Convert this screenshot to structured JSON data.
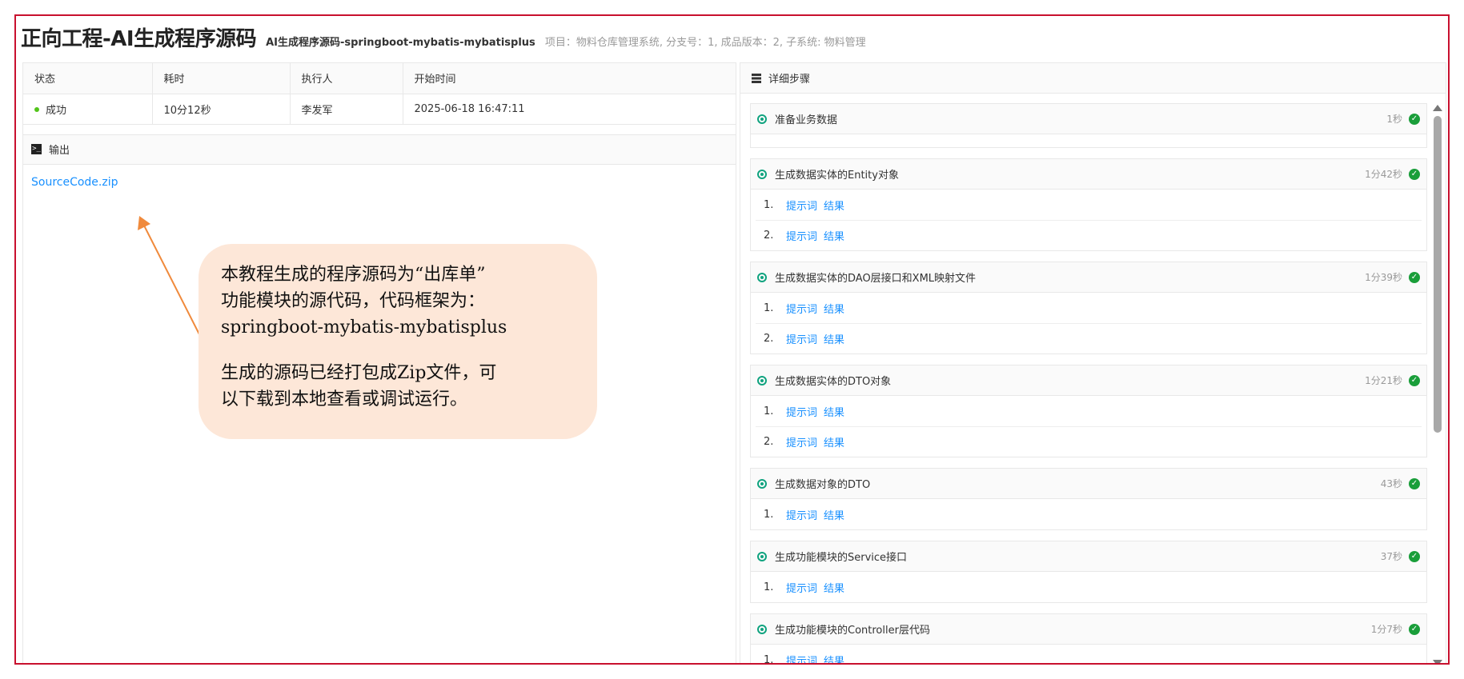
{
  "header": {
    "title": "正向工程-AI生成程序源码",
    "subtitle": "AI生成程序源码-springboot-mybatis-mybatisplus",
    "meta": "项目：物料仓库管理系统, 分支号：1, 成品版本：2, 子系统: 物料管理"
  },
  "info": {
    "columns": [
      "状态",
      "耗时",
      "执行人",
      "开始时间"
    ],
    "status": "成功",
    "duration": "10分12秒",
    "executor": "李发军",
    "start_time": "2025-06-18 16:47:11",
    "status_color": "#52c41a"
  },
  "output": {
    "label": "输出",
    "file": "SourceCode.zip"
  },
  "annotation": {
    "para1": "本教程生成的程序源码为“出库单”\n功能模块的源代码，代码框架为：\nspringboot-mybatis-mybatisplus",
    "para2": "生成的源码已经打包成Zip文件，可\n以下载到本地查看或调试运行。"
  },
  "steps_panel": {
    "label": "详细步骤",
    "link_prompt": "提示词",
    "link_result": "结果"
  },
  "steps": [
    {
      "title": "准备业务数据",
      "time": "1秒",
      "rows": []
    },
    {
      "title": "生成数据实体的Entity对象",
      "time": "1分42秒",
      "rows": [
        "1.",
        "2."
      ]
    },
    {
      "title": "生成数据实体的DAO层接口和XML映射文件",
      "time": "1分39秒",
      "rows": [
        "1.",
        "2."
      ]
    },
    {
      "title": "生成数据实体的DTO对象",
      "time": "1分21秒",
      "rows": [
        "1.",
        "2."
      ]
    },
    {
      "title": "生成数据对象的DTO",
      "time": "43秒",
      "rows": [
        "1."
      ]
    },
    {
      "title": "生成功能模块的Service接口",
      "time": "37秒",
      "rows": [
        "1."
      ]
    },
    {
      "title": "生成功能模块的Controller层代码",
      "time": "1分7秒",
      "rows": [
        "1."
      ]
    }
  ]
}
